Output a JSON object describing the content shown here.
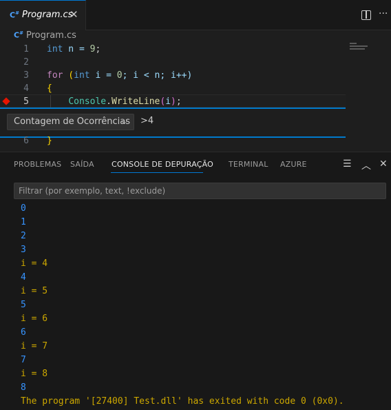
{
  "tab": {
    "icon": "csharp-file-icon",
    "title": "Program.cs",
    "close": "✕"
  },
  "toolbar": {
    "split_icon": "split-editor-icon",
    "more": "···"
  },
  "breadcrumb": {
    "file": "Program.cs"
  },
  "editor": {
    "line_numbers": [
      "1",
      "2",
      "3",
      "4",
      "5",
      "6"
    ],
    "breakpoint_line": 5,
    "code": {
      "l1": {
        "kw": "int",
        "rest": " n = ",
        "num": "9",
        "end": ";"
      },
      "l3": {
        "for": "for",
        "p1": " (",
        "kw": "int",
        "a": " i = ",
        "zero": "0",
        "b": "; i < n; i++)",
        "end": ""
      },
      "l4": {
        "brace": "{"
      },
      "l5": {
        "cls": "Console",
        "dot": ".",
        "fn": "WriteLine",
        "open": "(",
        "arg": "i",
        "close": ")",
        "semi": ";"
      },
      "l6": {
        "brace": "}"
      }
    }
  },
  "breakpoint_widget": {
    "type_label": "Contagem de Ocorrências",
    "condition": ">4"
  },
  "panel": {
    "tabs": [
      "PROBLEMAS",
      "SAÍDA",
      "CONSOLE DE DEPURAÇÃO",
      "TERMINAL",
      "AZURE"
    ],
    "active_tab": "CONSOLE DE DEPURAÇÃO",
    "filter_placeholder": "Filtrar (por exemplo, text, !exclude)",
    "output": [
      {
        "text": "0",
        "kind": "value"
      },
      {
        "text": "1",
        "kind": "value"
      },
      {
        "text": "2",
        "kind": "value"
      },
      {
        "text": "3",
        "kind": "value"
      },
      {
        "text": "i = 4",
        "kind": "log"
      },
      {
        "text": "4",
        "kind": "value"
      },
      {
        "text": "i = 5",
        "kind": "log"
      },
      {
        "text": "5",
        "kind": "value"
      },
      {
        "text": "i = 6",
        "kind": "log"
      },
      {
        "text": "6",
        "kind": "value"
      },
      {
        "text": "i = 7",
        "kind": "log"
      },
      {
        "text": "7",
        "kind": "value"
      },
      {
        "text": "i = 8",
        "kind": "log"
      },
      {
        "text": "8",
        "kind": "value"
      },
      {
        "text": "The program '[27400] Test.dll' has exited with code 0 (0x0).",
        "kind": "log"
      }
    ]
  },
  "colors": {
    "accent": "#0078d4",
    "breakpoint": "#e51400",
    "value_output": "#3794ff",
    "log_output": "#cca700"
  }
}
